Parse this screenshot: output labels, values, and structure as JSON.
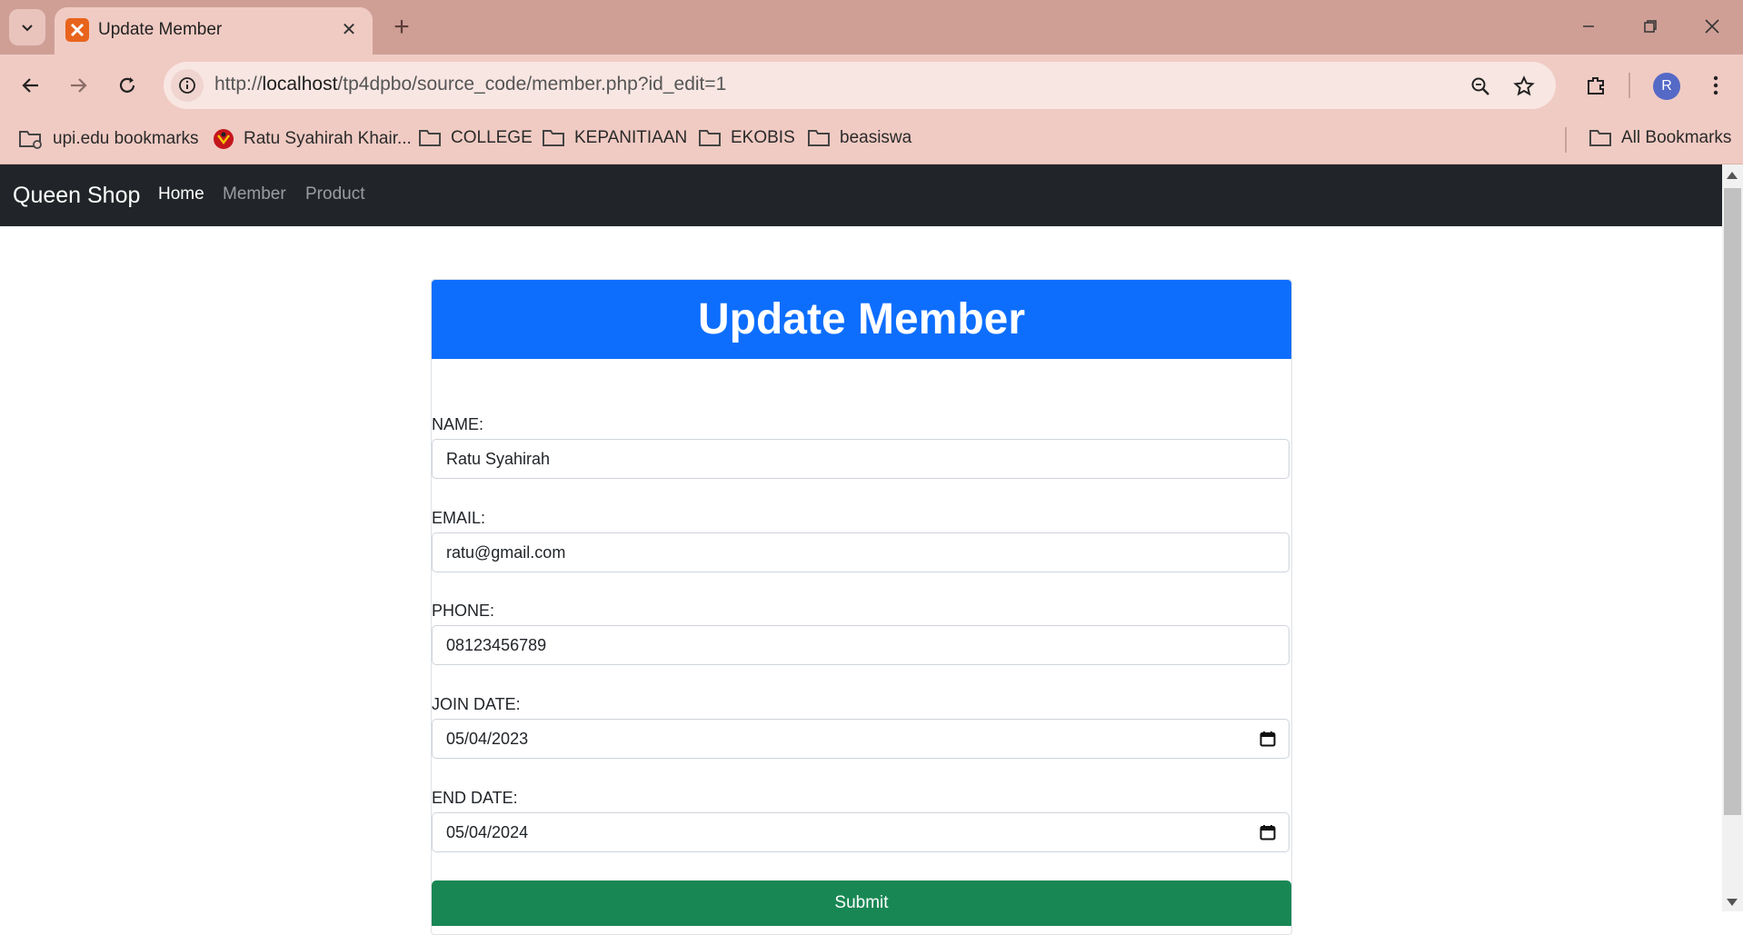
{
  "browser": {
    "tab_title": "Update Member",
    "url_host": "localhost",
    "url_prefix": "http://",
    "url_path": "/tp4dpbo/source_code/member.php?id_edit=1",
    "profile_initial": "R",
    "bookmarks": [
      {
        "label": "upi.edu bookmarks",
        "icon": "managed-folder-icon"
      },
      {
        "label": "Ratu Syahirah Khair...",
        "icon": "site-logo-icon"
      },
      {
        "label": "COLLEGE",
        "icon": "folder-icon"
      },
      {
        "label": "KEPANITIAAN",
        "icon": "folder-icon"
      },
      {
        "label": "EKOBIS",
        "icon": "folder-icon"
      },
      {
        "label": "beasiswa",
        "icon": "folder-icon"
      }
    ],
    "all_bookmarks": "All Bookmarks"
  },
  "navbar": {
    "brand": "Queen Shop",
    "links": [
      "Home",
      "Member",
      "Product"
    ],
    "active": "Home"
  },
  "form": {
    "title": "Update Member",
    "fields": [
      {
        "label": "NAME:",
        "value": "Ratu Syahirah",
        "type": "text"
      },
      {
        "label": "EMAIL:",
        "value": "ratu@gmail.com",
        "type": "text"
      },
      {
        "label": "PHONE:",
        "value": "08123456789",
        "type": "text"
      },
      {
        "label": "JOIN DATE:",
        "value": "05/04/2023",
        "type": "date"
      },
      {
        "label": "END DATE:",
        "value": "05/04/2024",
        "type": "date"
      }
    ],
    "submit": "Submit"
  },
  "colors": {
    "tabstrip": "#cf9f96",
    "toolbar": "#f0cbc3",
    "navbar": "#212529",
    "header": "#0d6efd",
    "submit": "#198754"
  }
}
